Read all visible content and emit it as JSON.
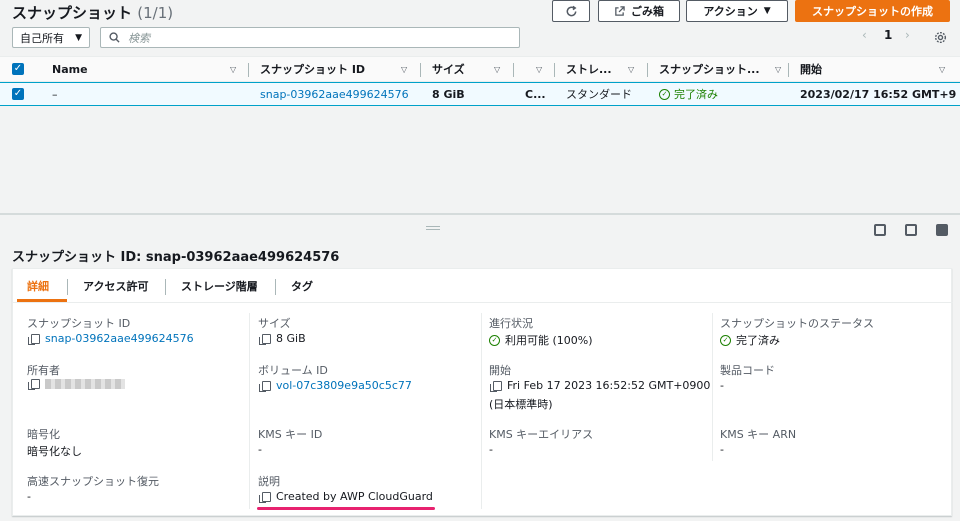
{
  "header": {
    "title": "スナップショット",
    "count": "(1/1)",
    "refresh_icon": "refresh-icon",
    "recycle_label": "ごみ箱",
    "actions_label": "アクション",
    "create_label": "スナップショットの作成"
  },
  "filter": {
    "owner_select": "自己所有",
    "search_placeholder": "検索"
  },
  "pager": {
    "page": "1"
  },
  "table": {
    "columns": [
      "Name",
      "スナップショット ID",
      "サイズ",
      "",
      "ストレ...",
      "スナップショット...",
      "開始"
    ],
    "rows": [
      {
        "name": "–",
        "snapshot_id": "snap-03962aae499624576",
        "size": "8 GiB",
        "desc": "C...",
        "storage": "スタンダード",
        "status": "完了済み",
        "started": "2023/02/17 16:52 GMT+9"
      }
    ]
  },
  "detail": {
    "title": "スナップショット ID: snap-03962aae499624576",
    "tabs": [
      "詳細",
      "アクセス許可",
      "ストレージ階層",
      "タグ"
    ],
    "fields": {
      "snapshot_id_label": "スナップショット ID",
      "snapshot_id_value": "snap-03962aae499624576",
      "size_label": "サイズ",
      "size_value": "8 GiB",
      "progress_label": "進行状況",
      "progress_value": "利用可能 (100%)",
      "status_label": "スナップショットのステータス",
      "status_value": "完了済み",
      "owner_label": "所有者",
      "volume_label": "ボリューム ID",
      "volume_value": "vol-07c3809e9a50c5c77",
      "started_label": "開始",
      "started_value": "Fri Feb 17 2023 16:52:52 GMT+0900",
      "started_value2": "(日本標準時)",
      "product_label": "製品コード",
      "product_value": "-",
      "encryption_label": "暗号化",
      "encryption_value": "暗号化なし",
      "kms_id_label": "KMS キー ID",
      "kms_id_value": "-",
      "kms_alias_label": "KMS キーエイリアス",
      "kms_alias_value": "-",
      "kms_arn_label": "KMS キー ARN",
      "kms_arn_value": "-",
      "fast_restore_label": "高速スナップショット復元",
      "fast_restore_value": "-",
      "desc_label": "説明",
      "desc_value": "Created by AWP CloudGuard"
    }
  },
  "colors": {
    "accent": "#ec7211",
    "link": "#0073bb",
    "success": "#1d8102",
    "highlight": "#e8226f"
  }
}
